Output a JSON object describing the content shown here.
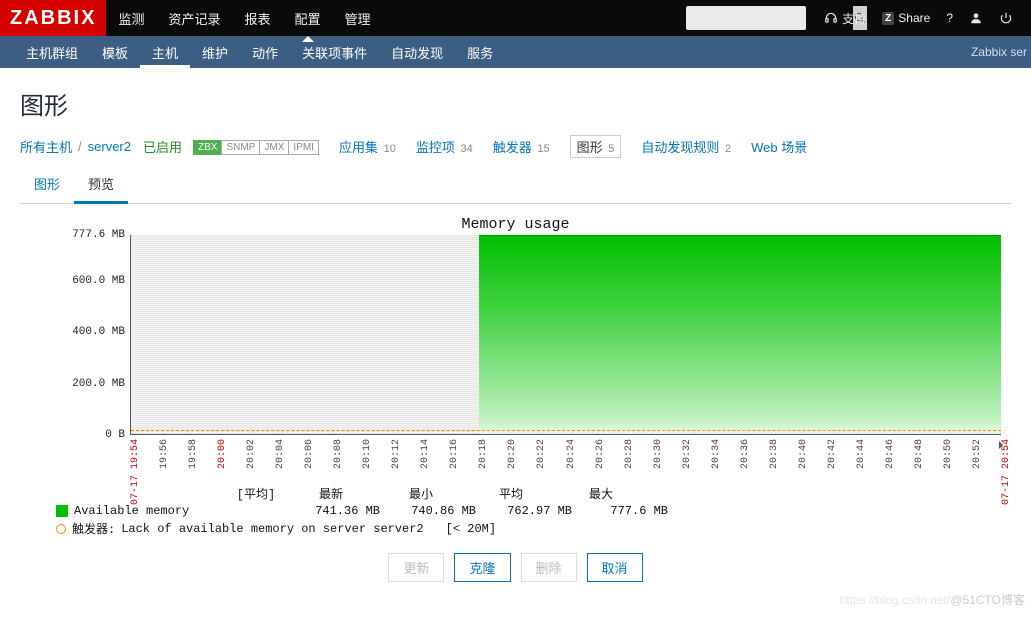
{
  "top": {
    "logo": "ZABBIX",
    "nav": [
      "监测",
      "资产记录",
      "报表",
      "配置",
      "管理"
    ],
    "active_index": 3,
    "support": "支持",
    "share": "Share",
    "help": "?",
    "search_placeholder": ""
  },
  "sub": {
    "nav": [
      "主机群组",
      "模板",
      "主机",
      "维护",
      "动作",
      "关联项事件",
      "自动发现",
      "服务"
    ],
    "active_index": 2,
    "right": "Zabbix ser"
  },
  "page_title": "图形",
  "breadcrumb": {
    "all_hosts": "所有主机",
    "host": "server2",
    "enabled": "已启用",
    "tags": [
      "ZBX",
      "SNMP",
      "JMX",
      "IPMI"
    ],
    "tag_active": 0,
    "sections": [
      {
        "label": "应用集",
        "count": 10
      },
      {
        "label": "监控项",
        "count": 34
      },
      {
        "label": "触发器",
        "count": 15
      },
      {
        "label": "图形",
        "count": 5,
        "current": true
      },
      {
        "label": "自动发现规则",
        "count": 2
      },
      {
        "label": "Web 场景",
        "count": null
      }
    ]
  },
  "tabs": {
    "items": [
      "图形",
      "预览"
    ],
    "active_index": 1
  },
  "chart_data": {
    "type": "area",
    "title": "Memory usage",
    "ylabel": "",
    "y_unit": "MB",
    "ylim": [
      0,
      777.6
    ],
    "y_ticks": [
      {
        "label": "777.6 MB",
        "value": 777.6
      },
      {
        "label": "600.0 MB",
        "value": 600.0
      },
      {
        "label": "400.0 MB",
        "value": 400.0
      },
      {
        "label": "200.0 MB",
        "value": 200.0
      },
      {
        "label": "0 B",
        "value": 0
      }
    ],
    "x_ticks": [
      "07-17 19:54",
      "19:56",
      "19:58",
      "20:00",
      "20:02",
      "20:04",
      "20:06",
      "20:08",
      "20:10",
      "20:12",
      "20:14",
      "20:16",
      "20:18",
      "20:20",
      "20:22",
      "20:24",
      "20:26",
      "20:28",
      "20:30",
      "20:32",
      "20:34",
      "20:36",
      "20:38",
      "20:40",
      "20:42",
      "20:44",
      "20:46",
      "20:48",
      "20:50",
      "20:52",
      "07-17 20:54"
    ],
    "x_red_indices": [
      0,
      3,
      30
    ],
    "series": [
      {
        "name": "Available memory",
        "color": "#00c000",
        "data_start_index": 12,
        "value_mb": 777.6
      }
    ],
    "triggers": [
      {
        "name": "Lack of available memory on server server2",
        "threshold_label": "< 20M",
        "threshold_value": 20
      }
    ],
    "stats": {
      "headers": [
        "最新",
        "最小",
        "平均",
        "最大"
      ],
      "header_prefix": "[平均]",
      "values": [
        "741.36 MB",
        "740.86 MB",
        "762.97 MB",
        "777.6 MB"
      ]
    },
    "trigger_label_prefix": "触发器:"
  },
  "buttons": {
    "update": "更新",
    "clone": "克隆",
    "delete": "删除",
    "cancel": "取消"
  },
  "watermark": {
    "left": "https://blog.csdn.net/",
    "right": "@51CTO博客"
  }
}
